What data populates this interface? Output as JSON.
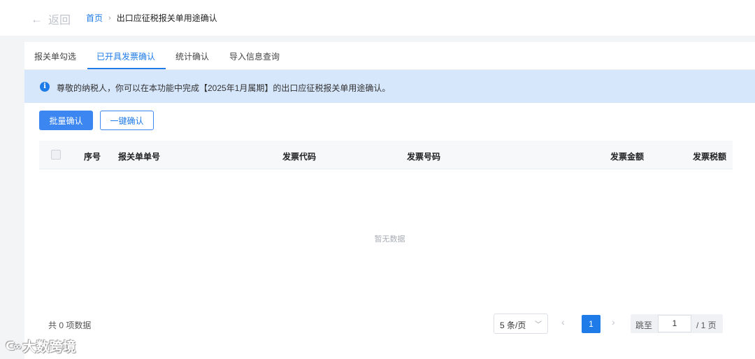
{
  "header": {
    "back_label": "返回",
    "breadcrumb_home": "首页",
    "breadcrumb_separator": "›",
    "breadcrumb_current": "出口应征税报关单用途确认"
  },
  "tabs": [
    {
      "label": "报关单勾选",
      "active": false
    },
    {
      "label": "已开具发票确认",
      "active": true
    },
    {
      "label": "统计确认",
      "active": false
    },
    {
      "label": "导入信息查询",
      "active": false
    }
  ],
  "notice": {
    "icon": "info-icon",
    "text": "尊敬的纳税人，你可以在本功能中完成【2025年1月属期】的出口应征税报关单用途确认。"
  },
  "actions": {
    "batch_confirm_label": "批量确认",
    "one_click_confirm_label": "一键确认"
  },
  "table": {
    "columns": [
      "序号",
      "报关单单号",
      "发票代码",
      "发票号码",
      "发票金额",
      "发票税额"
    ],
    "rows": [],
    "empty_text": "暂无数据"
  },
  "pagination": {
    "total_text": "共 0 项数据",
    "page_size": "5 条/页",
    "current_page": "1",
    "jump_label": "跳至",
    "jump_value": "1",
    "total_pages": "/ 1 页"
  },
  "watermark": {
    "text": "大数跨境"
  },
  "colors": {
    "primary": "#1e7be7",
    "button": "#3b86f0",
    "notice_bg": "#d6e6fb",
    "page_bg": "#f3f4f6"
  }
}
